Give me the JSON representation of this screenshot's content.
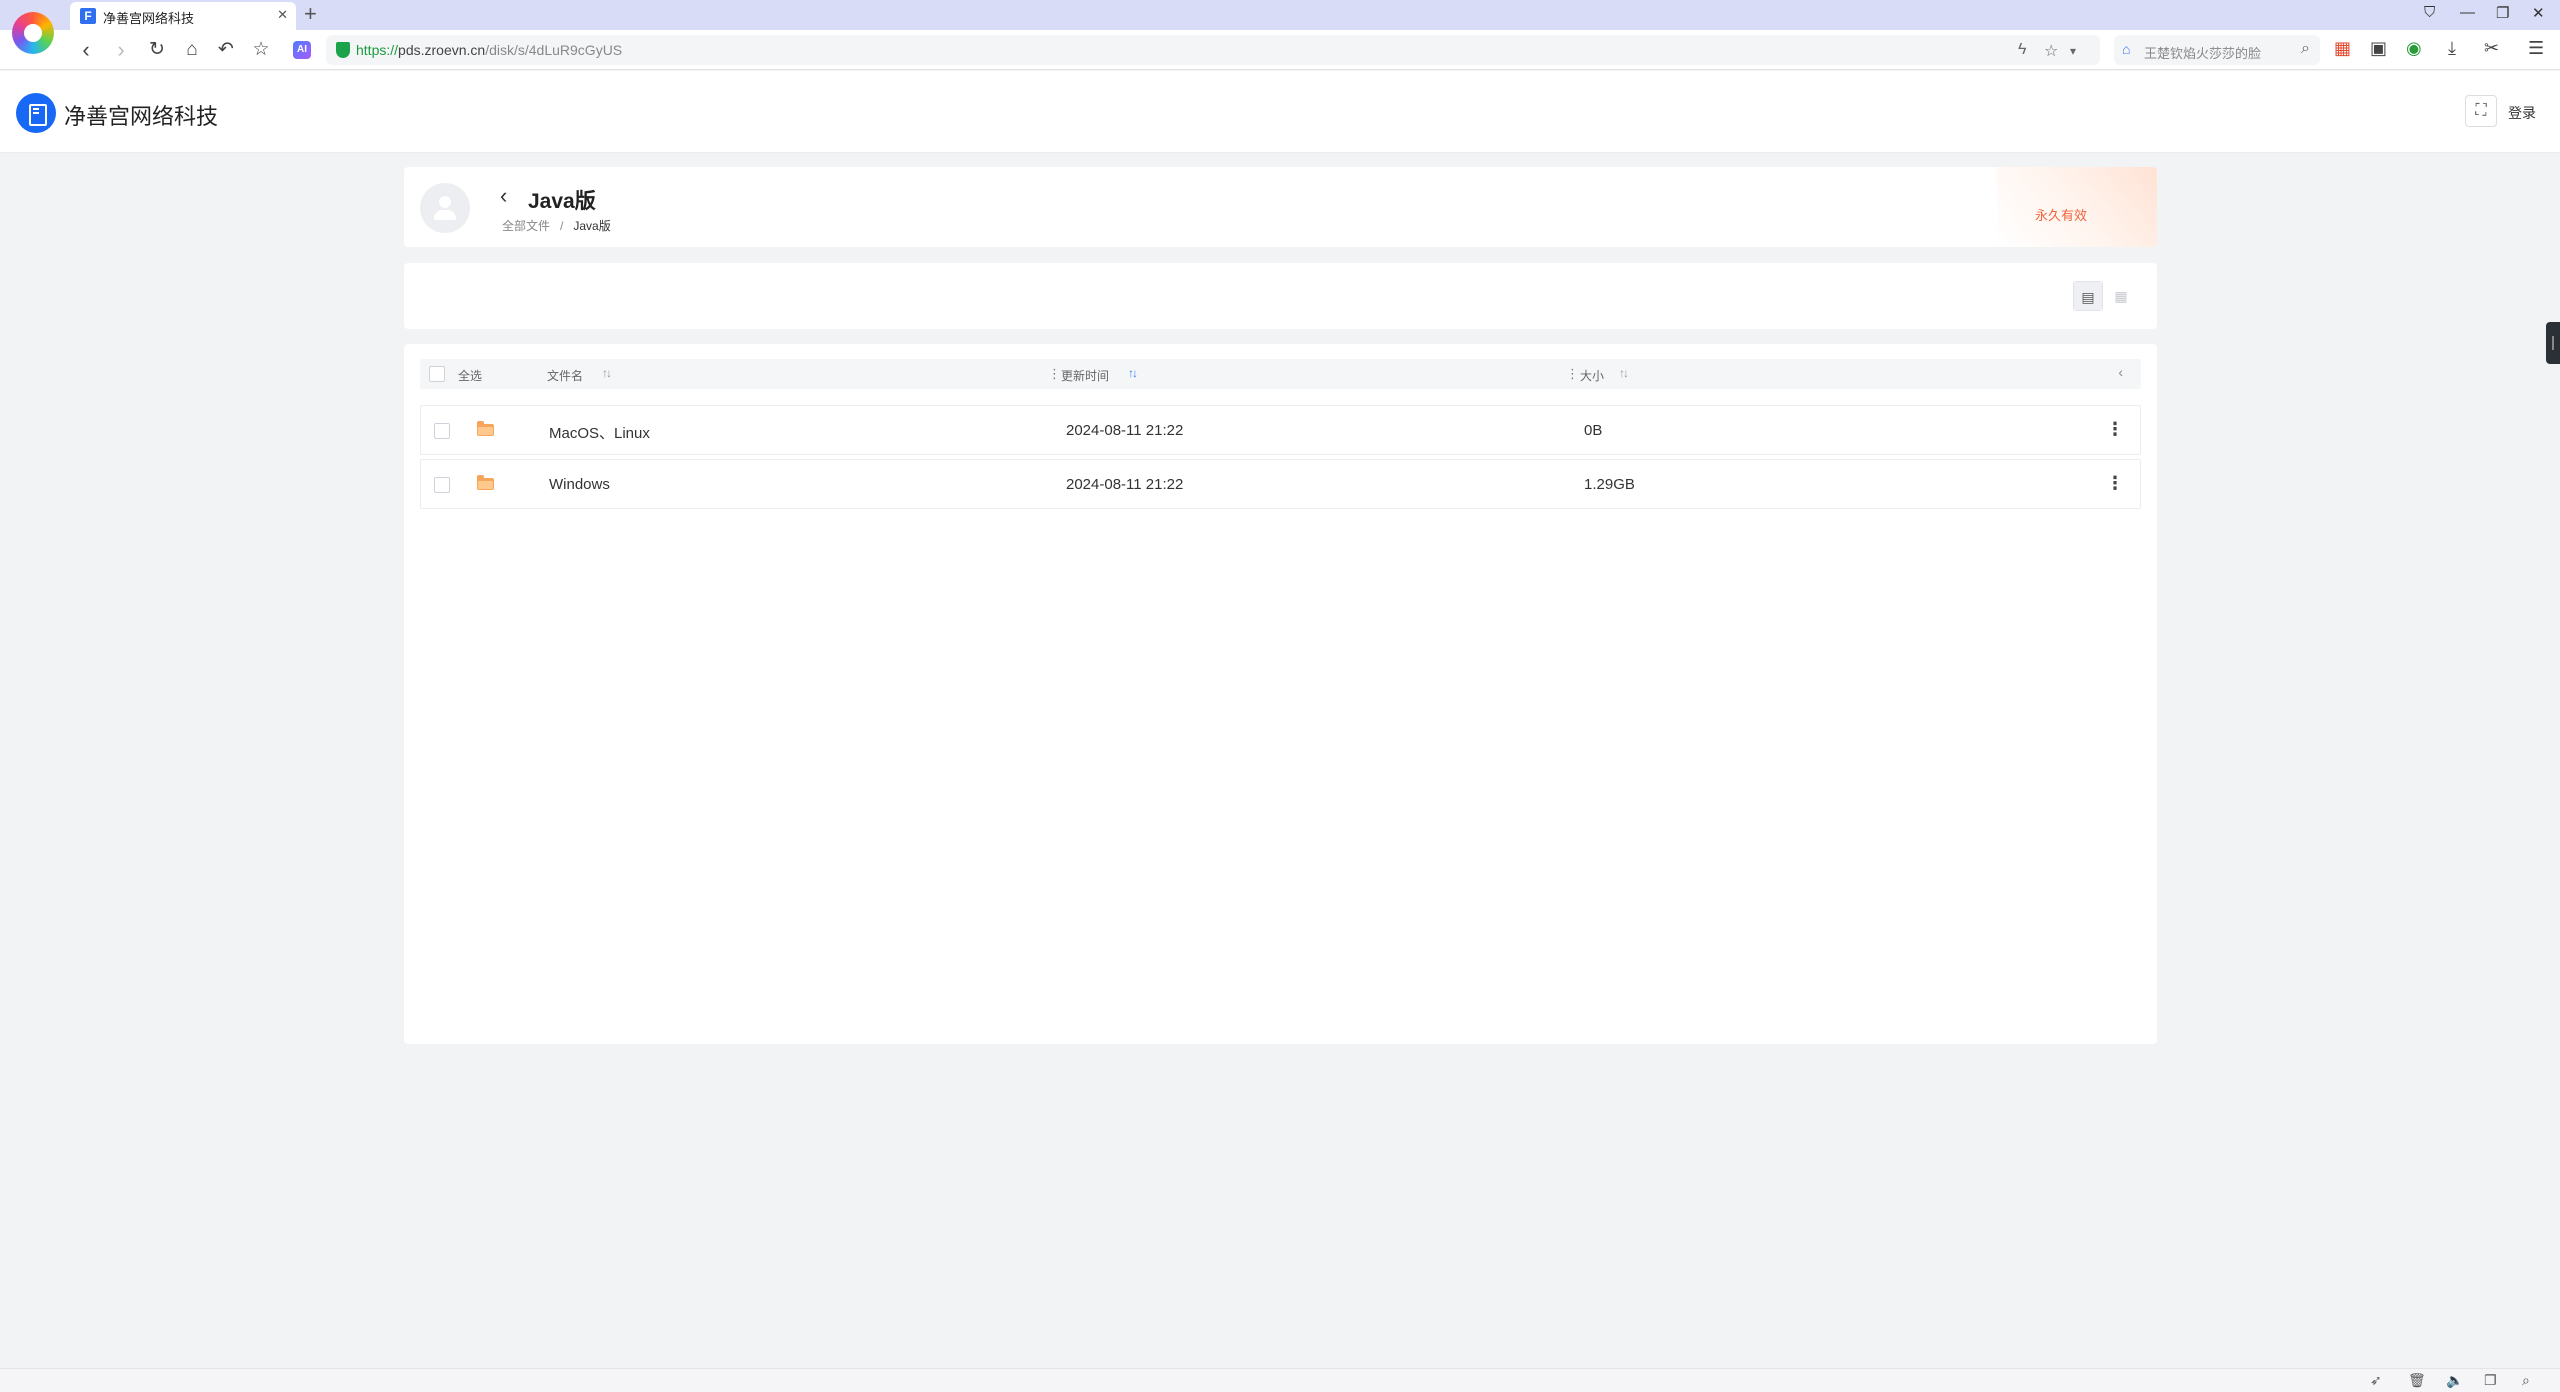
{
  "browser": {
    "tab_title": "净善宫网络科技",
    "tab_favicon": "F",
    "url_scheme": "https://",
    "url_host": "pds.zroevn.cn",
    "url_path": "/disk/s/4dLuR9cGyUS",
    "search_placeholder": "王楚钦焰火莎莎的脸",
    "ext_ai_label": "AI"
  },
  "header": {
    "brand_name": "净善宫网络科技",
    "login_label": "登录"
  },
  "share": {
    "folder_title": "Java版",
    "breadcrumb_root": "全部文件",
    "breadcrumb_sep": "/",
    "breadcrumb_current": "Java版",
    "validity": "永久有效"
  },
  "table": {
    "select_all": "全选",
    "col_name": "文件名",
    "col_time": "更新时间",
    "col_size": "大小",
    "rows": [
      {
        "name": "MacOS、Linux",
        "time": "2024-08-11 21:22",
        "size": "0B"
      },
      {
        "name": "Windows",
        "time": "2024-08-11 21:22",
        "size": "1.29GB"
      }
    ]
  },
  "colors": {
    "accent": "#1668f5",
    "validity": "#f0643c",
    "folder": "#f6a55a"
  }
}
